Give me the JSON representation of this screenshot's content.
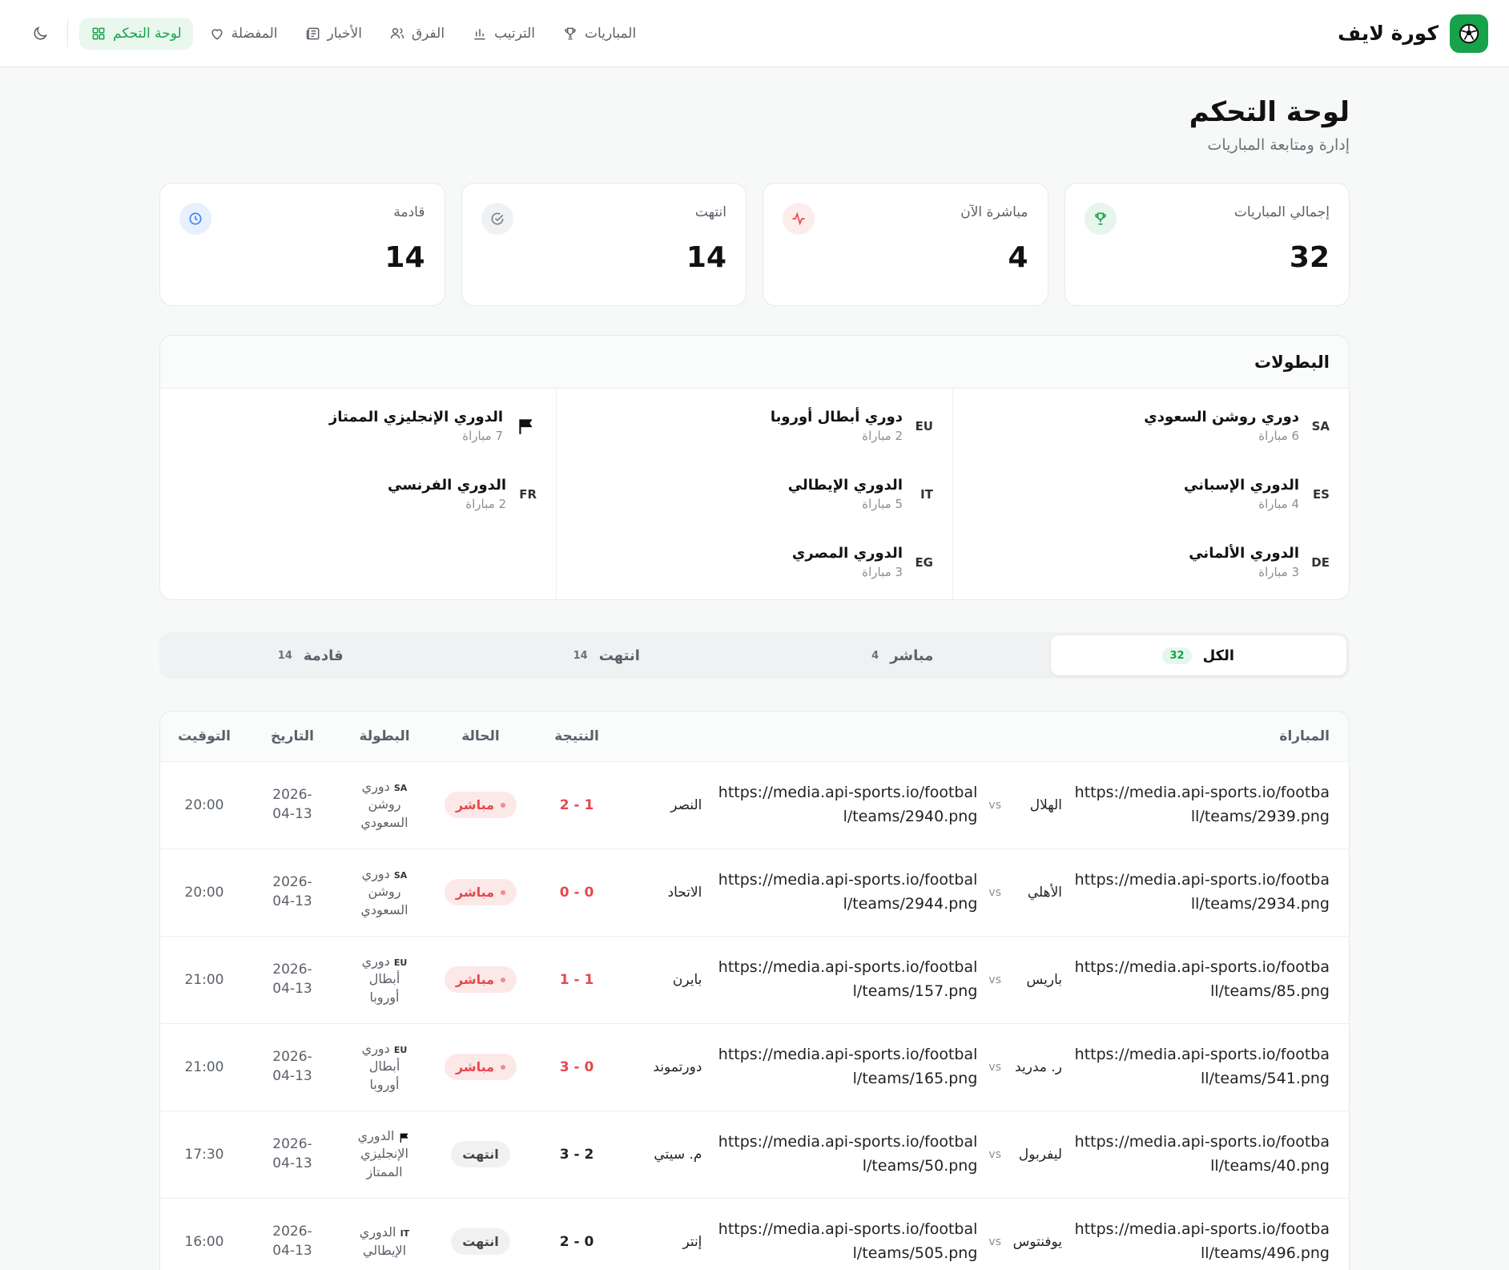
{
  "brand": {
    "name": "كورة لايف"
  },
  "nav": {
    "items": [
      {
        "label": "المباريات",
        "icon": "trophy-icon"
      },
      {
        "label": "الترتيب",
        "icon": "bar-chart-icon"
      },
      {
        "label": "الفرق",
        "icon": "users-icon"
      },
      {
        "label": "الأخبار",
        "icon": "newspaper-icon"
      },
      {
        "label": "المفضلة",
        "icon": "heart-icon"
      },
      {
        "label": "لوحة التحكم",
        "icon": "dashboard-icon",
        "active": true
      }
    ],
    "theme_toggle_icon": "moon-icon"
  },
  "page": {
    "title": "لوحة التحكم",
    "subtitle": "إدارة ومتابعة المباريات"
  },
  "stats": [
    {
      "label": "إجمالي المباريات",
      "value": "32",
      "icon": "trophy-icon"
    },
    {
      "label": "مباشرة الآن",
      "value": "4",
      "icon": "activity-icon"
    },
    {
      "label": "انتهت",
      "value": "14",
      "icon": "check-circle-icon"
    },
    {
      "label": "قادمة",
      "value": "14",
      "icon": "clock-icon"
    }
  ],
  "leagues": {
    "title": "البطولات",
    "columns": [
      [
        {
          "code": "SA",
          "name": "دوري روشن السعودي",
          "count": "6 مباراة"
        },
        {
          "code": "ES",
          "name": "الدوري الإسباني",
          "count": "4 مباراة"
        },
        {
          "code": "DE",
          "name": "الدوري الألماني",
          "count": "3 مباراة"
        }
      ],
      [
        {
          "code": "EU",
          "name": "دوري أبطال أوروبا",
          "count": "2 مباراة"
        },
        {
          "code": "IT",
          "name": "الدوري الإيطالي",
          "count": "5 مباراة"
        },
        {
          "code": "EG",
          "name": "الدوري المصري",
          "count": "3 مباراة"
        }
      ],
      [
        {
          "code": "",
          "icon": "flag-icon",
          "name": "الدوري الإنجليزي الممتاز",
          "count": "7 مباراة"
        },
        {
          "code": "FR",
          "name": "الدوري الفرنسي",
          "count": "2 مباراة"
        }
      ]
    ]
  },
  "tabs": [
    {
      "label": "الكل",
      "count": "32",
      "active": true
    },
    {
      "label": "مباشر",
      "count": "4"
    },
    {
      "label": "انتهت",
      "count": "14"
    },
    {
      "label": "قادمة",
      "count": "14"
    }
  ],
  "table": {
    "headers": {
      "match": "المباراة",
      "score": "النتيجة",
      "status": "الحالة",
      "league": "البطولة",
      "date": "التاريخ",
      "time": "التوقيت"
    },
    "vs_label": "vs",
    "rows": [
      {
        "home_logo": "https://media.api-sports.io/football/teams/2939.png",
        "home": "الهلال",
        "away_logo": "https://media.api-sports.io/football/teams/2940.png",
        "away": "النصر",
        "score": "1 - 2",
        "status": "مباشر",
        "live": true,
        "league_code": "SA",
        "league": "دوري روشن السعودي",
        "date": "2026-04-13",
        "time": "20:00"
      },
      {
        "home_logo": "https://media.api-sports.io/football/teams/2934.png",
        "home": "الأهلي",
        "away_logo": "https://media.api-sports.io/football/teams/2944.png",
        "away": "الاتحاد",
        "score": "0 - 0",
        "status": "مباشر",
        "live": true,
        "league_code": "SA",
        "league": "دوري روشن السعودي",
        "date": "2026-04-13",
        "time": "20:00"
      },
      {
        "home_logo": "https://media.api-sports.io/football/teams/85.png",
        "home": "باريس",
        "away_logo": "https://media.api-sports.io/football/teams/157.png",
        "away": "بايرن",
        "score": "1 - 1",
        "status": "مباشر",
        "live": true,
        "league_code": "EU",
        "league": "دوري أبطال أوروبا",
        "date": "2026-04-13",
        "time": "21:00"
      },
      {
        "home_logo": "https://media.api-sports.io/football/teams/541.png",
        "home": "ر. مدريد",
        "away_logo": "https://media.api-sports.io/football/teams/165.png",
        "away": "دورتموند",
        "score": "0 - 3",
        "status": "مباشر",
        "live": true,
        "league_code": "EU",
        "league": "دوري أبطال أوروبا",
        "date": "2026-04-13",
        "time": "21:00"
      },
      {
        "home_logo": "https://media.api-sports.io/football/teams/40.png",
        "home": "ليفربول",
        "away_logo": "https://media.api-sports.io/football/teams/50.png",
        "away": "م. سيتي",
        "score": "2 - 3",
        "status": "انتهت",
        "live": false,
        "league_code": "",
        "league_flag": true,
        "league": "الدوري الإنجليزي الممتاز",
        "date": "2026-04-13",
        "time": "17:30"
      },
      {
        "home_logo": "https://media.api-sports.io/football/teams/496.png",
        "home": "يوفنتوس",
        "away_logo": "https://media.api-sports.io/football/teams/505.png",
        "away": "إنتر",
        "score": "0 - 2",
        "status": "انتهت",
        "live": false,
        "league_code": "IT",
        "league": "الدوري الإيطالي",
        "date": "2026-04-13",
        "time": "16:00"
      }
    ]
  }
}
